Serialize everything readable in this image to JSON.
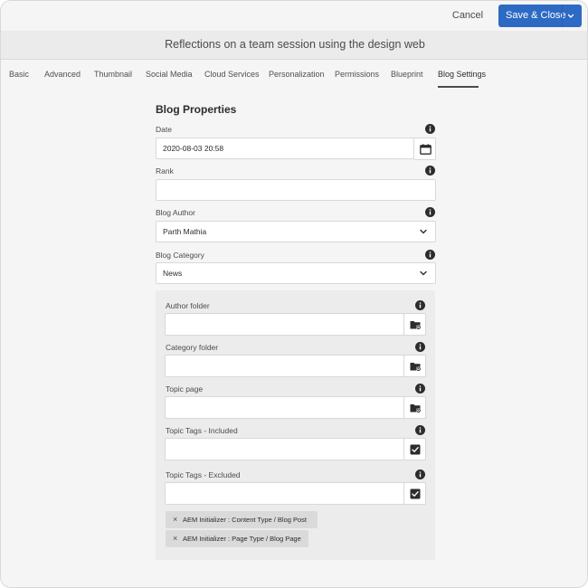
{
  "toolbar": {
    "cancel_label": "Cancel",
    "save_label": "Save & Close"
  },
  "page": {
    "title": "Reflections on a team session using the design web"
  },
  "tabs": [
    {
      "label": "Basic"
    },
    {
      "label": "Advanced"
    },
    {
      "label": "Thumbnail"
    },
    {
      "label": "Social Media"
    },
    {
      "label": "Cloud Services"
    },
    {
      "label": "Personalization"
    },
    {
      "label": "Permissions"
    },
    {
      "label": "Blueprint"
    },
    {
      "label": "Blog Settings",
      "active": true
    }
  ],
  "form": {
    "heading": "Blog Properties",
    "date": {
      "label": "Date",
      "value": "2020-08-03 20:58"
    },
    "rank": {
      "label": "Rank",
      "value": ""
    },
    "author": {
      "label": "Blog Author",
      "value": "Parth Mathia"
    },
    "category": {
      "label": "Blog Category",
      "value": "News"
    }
  },
  "panel": {
    "author_folder": {
      "label": "Author folder",
      "value": ""
    },
    "category_folder": {
      "label": "Category folder",
      "value": ""
    },
    "topic_page": {
      "label": "Topic page",
      "value": ""
    },
    "tags_included": {
      "label": "Topic Tags - Included",
      "value": ""
    },
    "tags_excluded": {
      "label": "Topic Tags - Excluded",
      "value": ""
    },
    "tags": [
      {
        "label": "AEM Initializer : Content Type / Blog Post"
      },
      {
        "label": "AEM Initializer : Page Type / Blog Page"
      }
    ]
  },
  "colors": {
    "primary_button": "#2d6ac4",
    "background": "#f5f5f5",
    "panel": "#ececec",
    "field_border": "#d8d8d8",
    "tag": "#dadada"
  },
  "icons": {
    "info": "info-icon",
    "calendar": "calendar-icon",
    "dropdown": "chevron-down-icon",
    "folder": "folder-picker-icon",
    "tags": "tag-picker-icon",
    "remove": "close-icon"
  }
}
